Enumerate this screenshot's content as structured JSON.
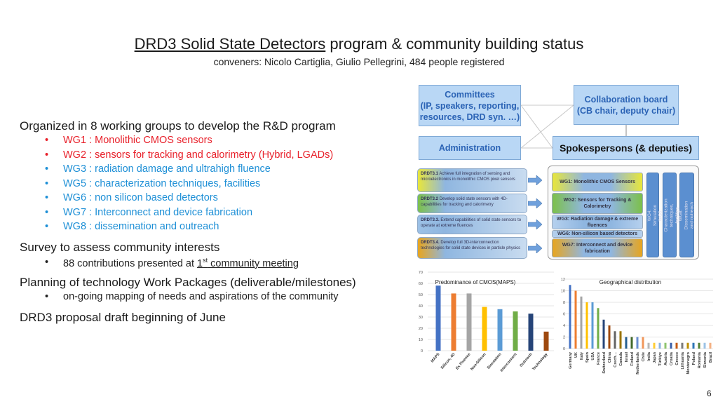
{
  "title": {
    "underlined": "DRD3 Solid State Detectors",
    "rest": " program & community building status"
  },
  "subtitle": "conveners: Nicolo Cartiglia, Giulio Pellegrini, 484 people registered",
  "left": {
    "h1": "Organized in 8 working groups to develop the R&D program",
    "wg_items": [
      {
        "text": "WG1 : Monolithic CMOS sensors",
        "color": "#e8202a"
      },
      {
        "text": "WG2 : sensors for tracking and calorimetry (Hybrid, LGADs)",
        "color": "#e8202a"
      },
      {
        "text": "WG3 : radiation damage and ultrahigh fluence",
        "color": "#1d8fd6"
      },
      {
        "text": "WG5 : characterization techniques, facilities",
        "color": "#1d8fd6"
      },
      {
        "text": "WG6 : non silicon based detectors",
        "color": "#1d8fd6"
      },
      {
        "text": "WG7 : Interconnect and device fabrication",
        "color": "#1d8fd6"
      },
      {
        "text": "WG8 : dissemination and outreach",
        "color": "#1d8fd6"
      }
    ],
    "h2": "Survey to assess community interests",
    "survey_bullet": {
      "pre": "88 contributions presented at ",
      "num": "1",
      "sup": "st",
      "post": " community meeting"
    },
    "h3": "Planning of technology Work Packages (deliverable/milestones)",
    "planning_bullet": "on-going mapping of needs and aspirations of the community",
    "h4": "DRD3 proposal draft beginning of June"
  },
  "org": {
    "committees": [
      "Committees",
      "(IP, speakers, reporting,",
      "resources, DRD syn. …)"
    ],
    "collab_board": [
      "Collaboration board",
      "(CB chair, deputy chair)"
    ],
    "administration": "Administration",
    "spokespersons": "Spokespersons (& deputies)"
  },
  "drdt": [
    {
      "id": "DRDT3.1",
      "text": "Achieve full integration of sensing and microelectronics in monolithic CMOS pixel sensors",
      "color": "#e8e63a"
    },
    {
      "id": "DRDT3.2",
      "text": "Develop solid state sensors with 4D-capabilities for tracking and calorimetry",
      "color": "#7cc04a"
    },
    {
      "id": "DRDT3.3.",
      "text": "Extend capabilities of solid state sensors to operate at extreme fluences",
      "color": "#9cc1e6"
    },
    {
      "id": "DRDT3.4.",
      "text": "Develop full 3D-interconnection technologies for solid state devices in particle physics",
      "color": "#e8a51e"
    }
  ],
  "wgs": [
    {
      "label": "WG1: Monolithic CMOS Sensors",
      "color": "#e8e63a"
    },
    {
      "label": "WG2: Sensors for Tracking & Calorimetry",
      "color": "#7cc04a"
    },
    {
      "label": "WG3: Radiation damage & extreme fluences",
      "color": "#b5d0ee"
    },
    {
      "label": "WG6: Non-silicon based detectors",
      "color": "#b5d0ee"
    },
    {
      "label": "WG7: Interconnect and device fabrication",
      "color": "#e8a51e"
    }
  ],
  "vertical_wgs": [
    "WG4: Simulation",
    "WG5: Characterization techniques, facilities",
    "WG8: Dissemination and outreach"
  ],
  "chart_data": [
    {
      "type": "bar",
      "title": "Predominance of CMOS(MAPS)",
      "categories": [
        "MAPS",
        "Silicon, 4D",
        "Ex Fluence",
        "Non-Silicon",
        "Simulation",
        "Interconnect",
        "Outreach",
        "Technology"
      ],
      "values": [
        58,
        51,
        51,
        39,
        37,
        35,
        33,
        17
      ],
      "ylim": [
        0,
        70
      ],
      "yticks": [
        0,
        10,
        20,
        30,
        40,
        50,
        60,
        70
      ],
      "colors": [
        "#4472c4",
        "#ed7d31",
        "#a5a5a5",
        "#ffc000",
        "#5b9bd5",
        "#70ad47",
        "#264478",
        "#9e480e"
      ],
      "grid": true
    },
    {
      "type": "bar",
      "title": "Geographical distribution",
      "categories": [
        "Germany",
        "UK",
        "Italy",
        "Spain",
        "USA",
        "France",
        "Switzerland",
        "China",
        "Czech…",
        "Canada",
        "Israel",
        "Finland",
        "Netherlands",
        "Chile",
        "India",
        "Japan",
        "Türkiye",
        "Austria",
        "Croatia",
        "Greece",
        "Lithuania",
        "Montenegro",
        "Poland",
        "Romania",
        "Slovenia",
        "Brazil"
      ],
      "values": [
        11,
        10,
        9,
        8,
        8,
        7,
        5,
        4,
        3,
        3,
        2,
        2,
        2,
        2,
        1,
        1,
        1,
        1,
        1,
        1,
        1,
        1,
        1,
        1,
        1,
        1
      ],
      "ylim": [
        0,
        12
      ],
      "yticks": [
        0,
        2,
        4,
        6,
        8,
        10,
        12
      ],
      "colors": [
        "#4472c4",
        "#ed7d31",
        "#a5a5a5",
        "#ffc000",
        "#5b9bd5",
        "#70ad47",
        "#264478",
        "#9e480e",
        "#636363",
        "#997300",
        "#255e91",
        "#43682b",
        "#698ed0",
        "#f1975a",
        "#b7b7b7",
        "#ffcd33",
        "#8cb4e0",
        "#8fc46f",
        "#3a5fa8",
        "#c55a11",
        "#7b7b7b",
        "#bf9000",
        "#2e75b6",
        "#548235",
        "#9dc3e6",
        "#f4b183"
      ],
      "grid": true
    }
  ],
  "page_number": "6"
}
